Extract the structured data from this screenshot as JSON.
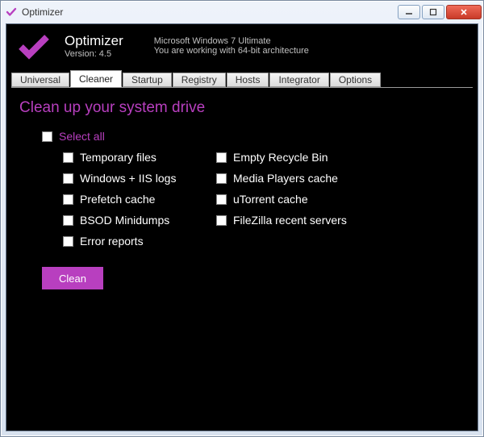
{
  "window": {
    "title": "Optimizer"
  },
  "header": {
    "app_name": "Optimizer",
    "version_label": "Version: 4.5",
    "os_line1": "Microsoft Windows 7 Ultimate",
    "os_line2": "You are working with 64-bit architecture"
  },
  "tabs": [
    {
      "label": "Universal"
    },
    {
      "label": "Cleaner"
    },
    {
      "label": "Startup"
    },
    {
      "label": "Registry"
    },
    {
      "label": "Hosts"
    },
    {
      "label": "Integrator"
    },
    {
      "label": "Options"
    }
  ],
  "active_tab_index": 1,
  "page": {
    "title": "Clean up your system drive",
    "select_all_label": "Select all",
    "left_items": [
      "Temporary files",
      "Windows + IIS logs",
      "Prefetch cache",
      "BSOD Minidumps",
      "Error reports"
    ],
    "right_items": [
      "Empty Recycle Bin",
      "Media Players cache",
      "uTorrent cache",
      "FileZilla recent servers"
    ],
    "clean_button": "Clean"
  },
  "colors": {
    "accent": "#b83fbf"
  }
}
